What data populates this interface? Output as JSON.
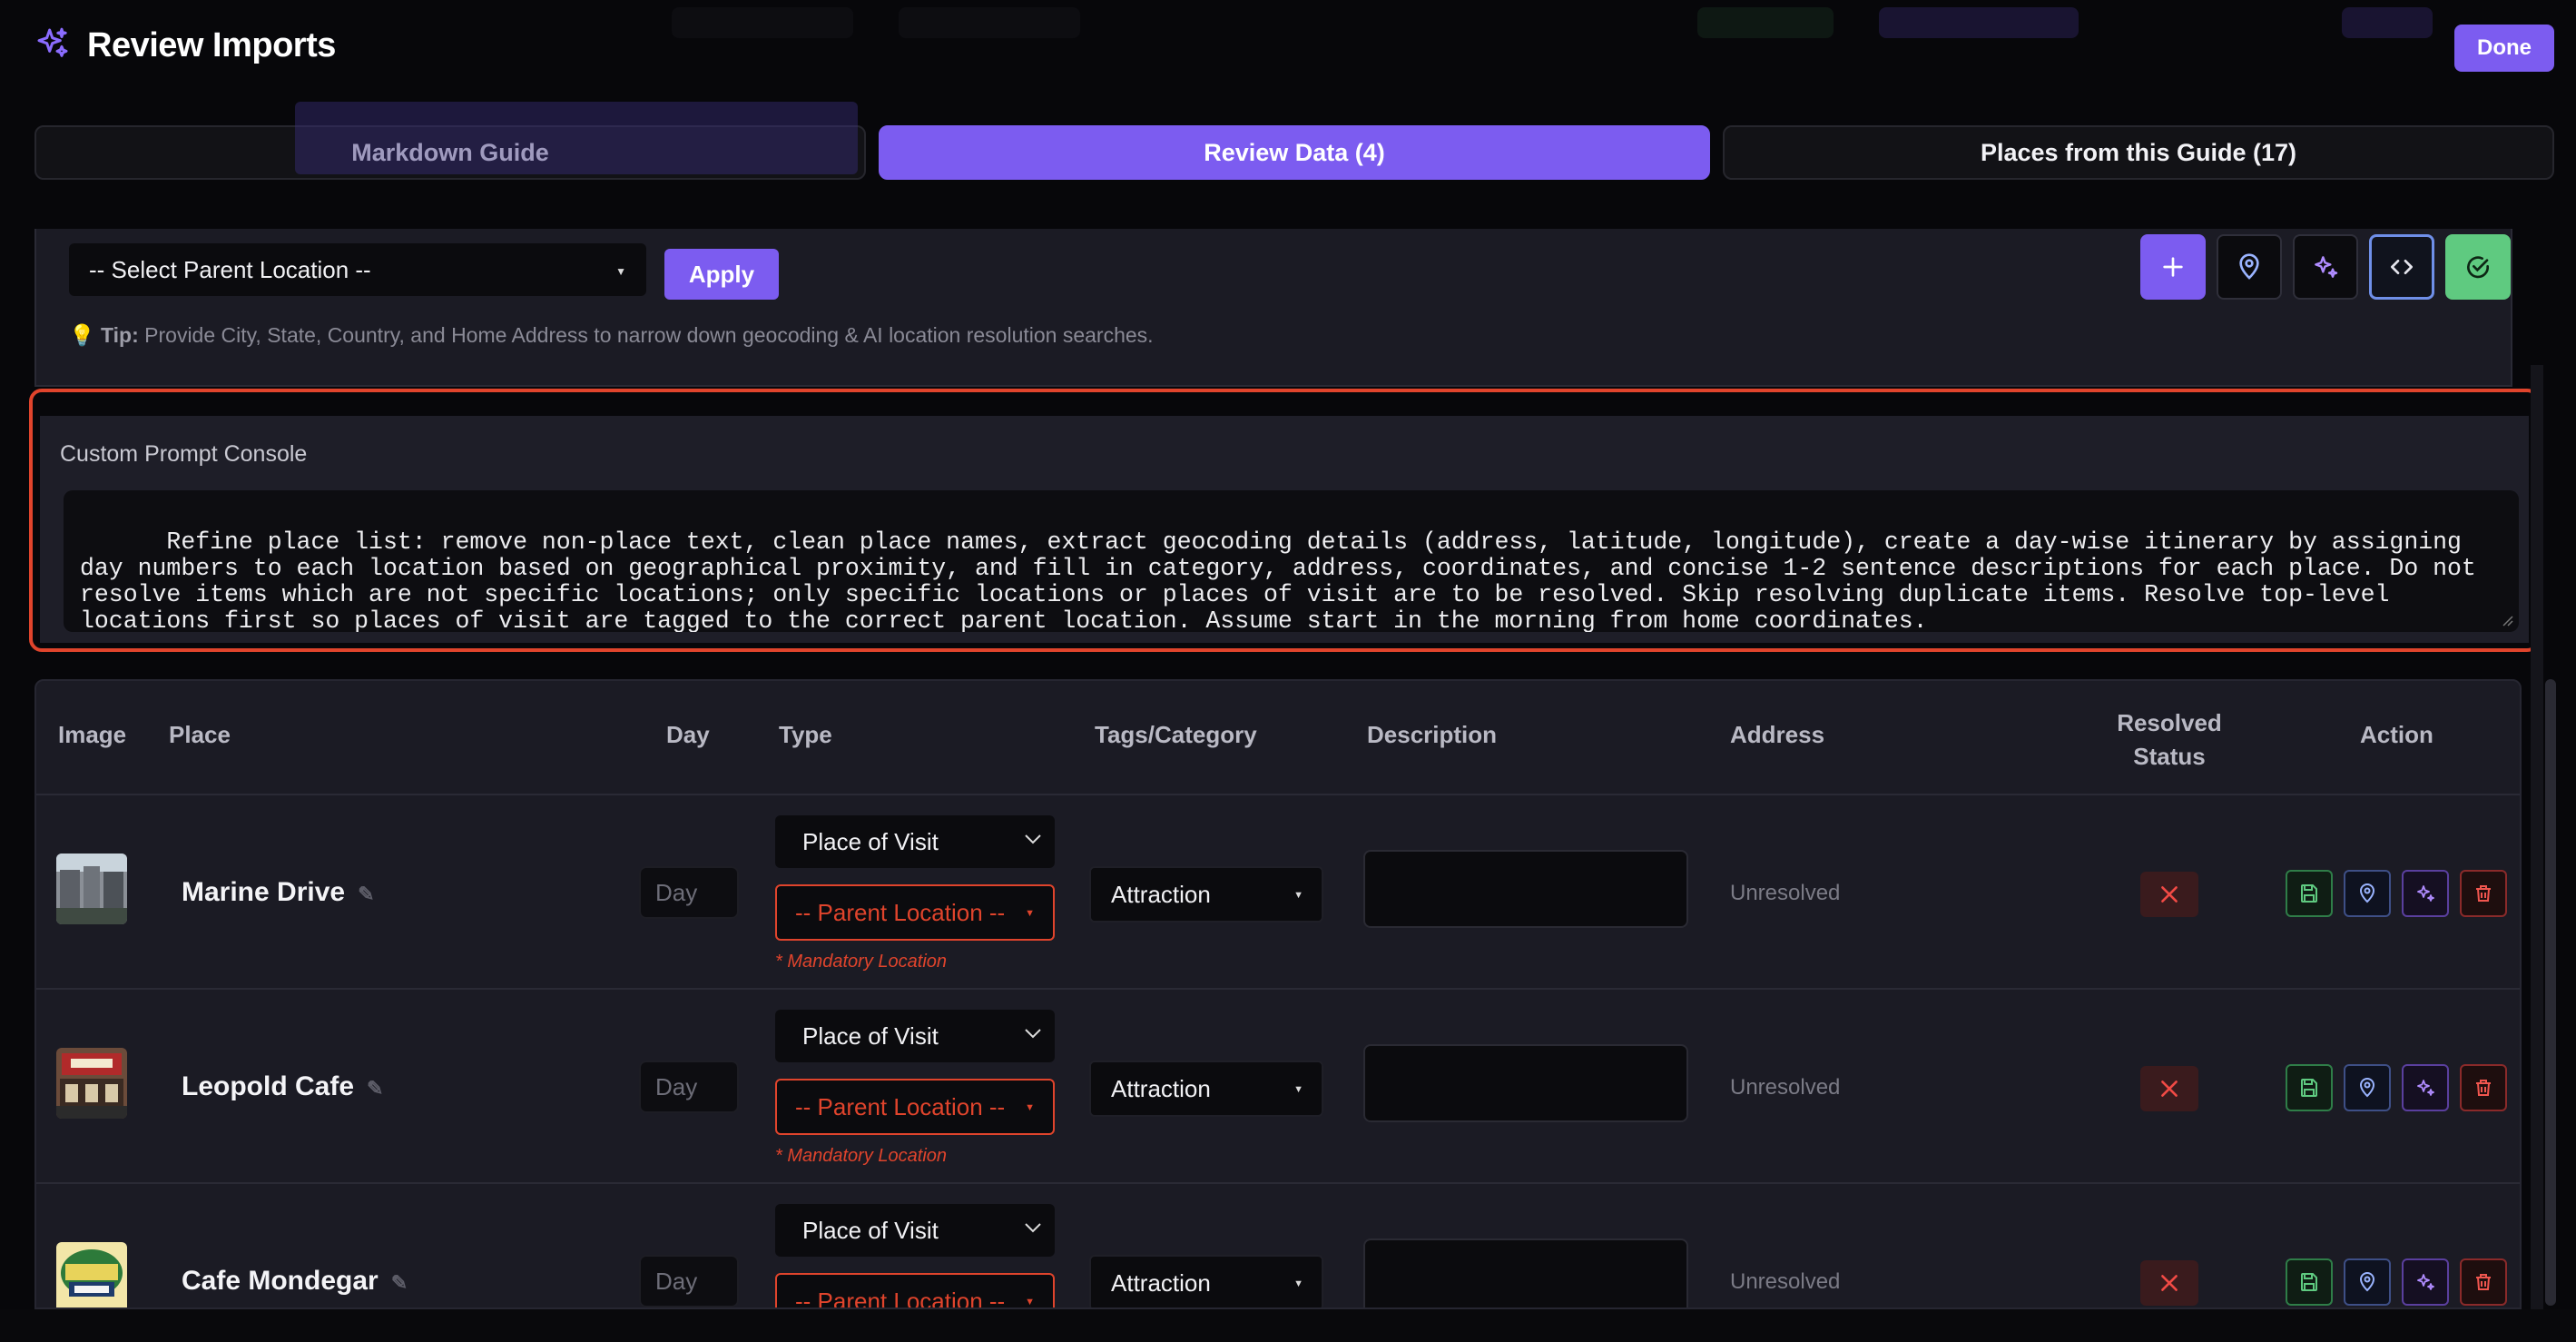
{
  "header": {
    "title": "Review Imports",
    "done_label": "Done"
  },
  "tabs": [
    {
      "label": "Markdown Guide",
      "active": false
    },
    {
      "label": "Review Data (4)",
      "active": true
    },
    {
      "label": "Places from this Guide (17)",
      "active": false
    }
  ],
  "toolbar": {
    "parent_select_value": "-- Select Parent Location --",
    "apply_label": "Apply",
    "tip_label": "Tip:",
    "tip_text": "Provide City, State, Country, and Home Address to narrow down geocoding & AI location resolution searches.",
    "buttons": [
      "plus-icon",
      "map-pin-icon",
      "sparkles-icon",
      "code-icon",
      "check-circle-icon"
    ]
  },
  "console": {
    "label": "Custom Prompt Console",
    "text": "Refine place list: remove non-place text, clean place names, extract geocoding details (address, latitude, longitude), create a day-wise itinerary by assigning day numbers to each location based on geographical proximity, and fill in category, address, coordinates, and concise 1-2 sentence descriptions for each place. Do not resolve items which are not specific locations; only specific locations or places of visit are to be resolved. Skip resolving duplicate items. Resolve top-level locations first so places of visit are tagged to the correct parent location. Assume start in the morning from home coordinates."
  },
  "table": {
    "headers": {
      "image": "Image",
      "place": "Place",
      "day": "Day",
      "type": "Type",
      "tags": "Tags/Category",
      "description": "Description",
      "address": "Address",
      "resolved_1": "Resolved",
      "resolved_2": "Status",
      "action": "Action"
    },
    "rows": [
      {
        "place": "Marine Drive",
        "day_placeholder": "Day",
        "type": "Place of Visit",
        "parent": "-- Parent Location --",
        "mandatory": "* Mandatory Location",
        "tag": "Attraction",
        "address": "Unresolved"
      },
      {
        "place": "Leopold Cafe",
        "day_placeholder": "Day",
        "type": "Place of Visit",
        "parent": "-- Parent Location --",
        "mandatory": "* Mandatory Location",
        "tag": "Attraction",
        "address": "Unresolved"
      },
      {
        "place": "Cafe Mondegar",
        "day_placeholder": "Day",
        "type": "Place of Visit",
        "parent": "-- Parent Location --",
        "mandatory": "",
        "tag": "Attraction",
        "address": "Unresolved"
      }
    ]
  },
  "colors": {
    "accent": "#7c5cf0",
    "danger": "#e0442c",
    "success": "#55c37a",
    "background": "#07070a"
  }
}
